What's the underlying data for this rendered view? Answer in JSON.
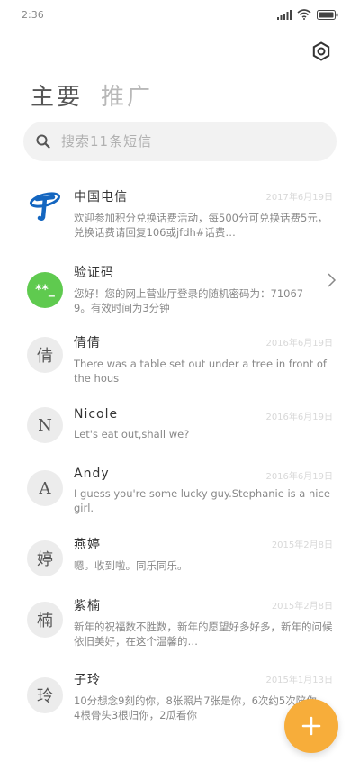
{
  "status_bar": {
    "time": "2:36"
  },
  "tabs": [
    {
      "label": "主要",
      "active": true
    },
    {
      "label": "推广",
      "active": false
    }
  ],
  "search": {
    "placeholder": "搜索11条短信"
  },
  "colors": {
    "accent": "#f7ad3a",
    "verification_avatar": "#5fca4f",
    "telecom_blue": "#1466c0"
  },
  "conversations": [
    {
      "name": "中国电信",
      "date": "2017年6月19日",
      "snippet": "欢迎参加积分兑换话费活动，每500分可兑换话费5元，兑换话费请回复106或jfdh#话费…",
      "avatar": "telecom-logo"
    },
    {
      "name": "验证码",
      "date": "",
      "snippet": "您好！您的网上营业厅登录的随机密码为：710679。有效时间为3分钟",
      "avatar": "**_"
    },
    {
      "name": "倩倩",
      "date": "2016年6月19日",
      "snippet": "There was a table set out under a tree in front of the hous",
      "avatar": "倩"
    },
    {
      "name": "Nicole",
      "date": "2016年6月19日",
      "snippet": "Let's eat out,shall we?",
      "avatar": "N"
    },
    {
      "name": "Andy",
      "date": "2016年6月19日",
      "snippet": "I guess you're some lucky guy.Stephanie is a nice girl.",
      "avatar": "A"
    },
    {
      "name": "燕婷",
      "date": "2015年2月8日",
      "snippet": "嗯。收到啦。同乐同乐。",
      "avatar": "婷"
    },
    {
      "name": "紫楠",
      "date": "2015年2月8日",
      "snippet": "新年的祝福数不胜数，新年的愿望好多好多，新年的问候依旧美好，在这个温馨的…",
      "avatar": "楠"
    },
    {
      "name": "子玲",
      "date": "2015年1月13日",
      "snippet": "10分想念9刻的你，8张照片7张是你，6次约5次陪你，4根骨头3根归你，2瓜看你",
      "avatar": "玲"
    }
  ]
}
